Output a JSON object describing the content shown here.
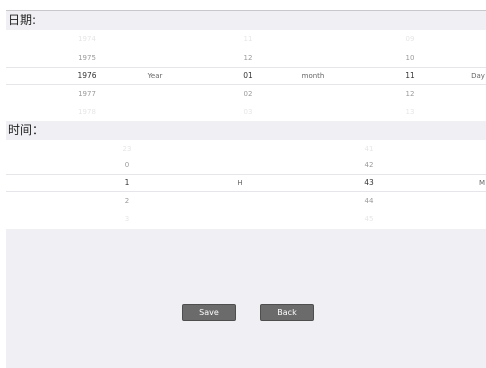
{
  "date_section": {
    "title": "日期:",
    "units": {
      "year": "Year",
      "month": "month",
      "day": "Day"
    },
    "years": [
      "1974",
      "1975",
      "1976",
      "1977",
      "1978"
    ],
    "months": [
      "11",
      "12",
      "01",
      "02",
      "03"
    ],
    "days": [
      "09",
      "10",
      "11",
      "12",
      "13"
    ]
  },
  "time_section": {
    "title": "时间：",
    "units": {
      "hour": "H",
      "minute": "M"
    },
    "hours": [
      "23",
      "0",
      "1",
      "2",
      "3"
    ],
    "minutes": [
      "41",
      "42",
      "43",
      "44",
      "45"
    ]
  },
  "buttons": {
    "save": "Save",
    "back": "Back"
  }
}
